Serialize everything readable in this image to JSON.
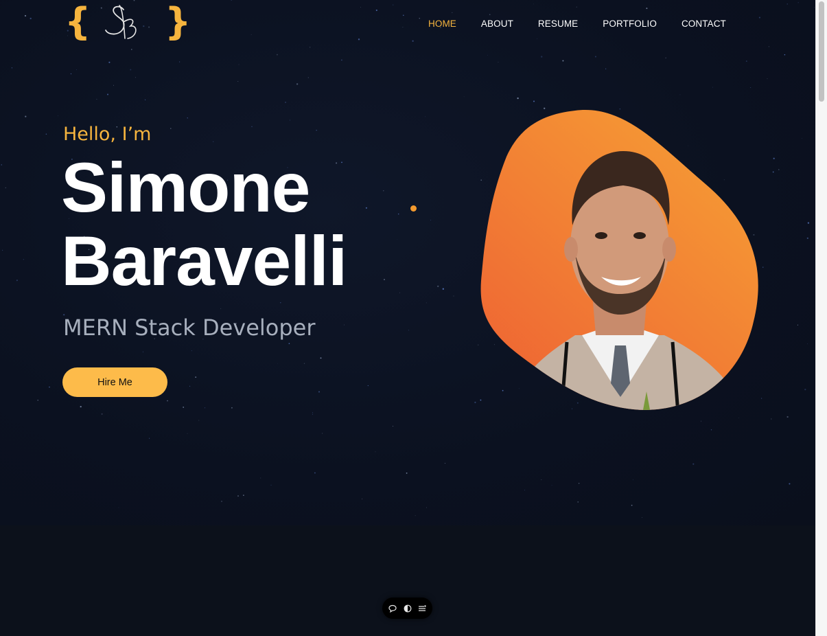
{
  "logo": {
    "left_brace": "{",
    "right_brace": "}",
    "monogram": "SB",
    "accent": "#f6b43e"
  },
  "nav": {
    "items": [
      {
        "label": "HOME",
        "active": true
      },
      {
        "label": "ABOUT",
        "active": false
      },
      {
        "label": "RESUME",
        "active": false
      },
      {
        "label": "PORTFOLIO",
        "active": false
      },
      {
        "label": "CONTACT",
        "active": false
      }
    ]
  },
  "hero": {
    "greeting": "Hello, I’m",
    "first_name": "Simone",
    "last_name": "Baravelli",
    "role": "MERN Stack Developer",
    "cta_label": "Hire Me"
  },
  "portrait": {
    "icon": "profile-photo",
    "gradient": [
      "#f6a035",
      "#ef6a33"
    ]
  },
  "toolbar": {
    "icons": [
      "chat-bubble-icon",
      "toggle-icon",
      "menu-lines-icon"
    ]
  },
  "colors": {
    "background": "#0b111e",
    "accent": "#f6b43e",
    "button": "#fdbb4a",
    "muted_text": "#a7afbd"
  }
}
